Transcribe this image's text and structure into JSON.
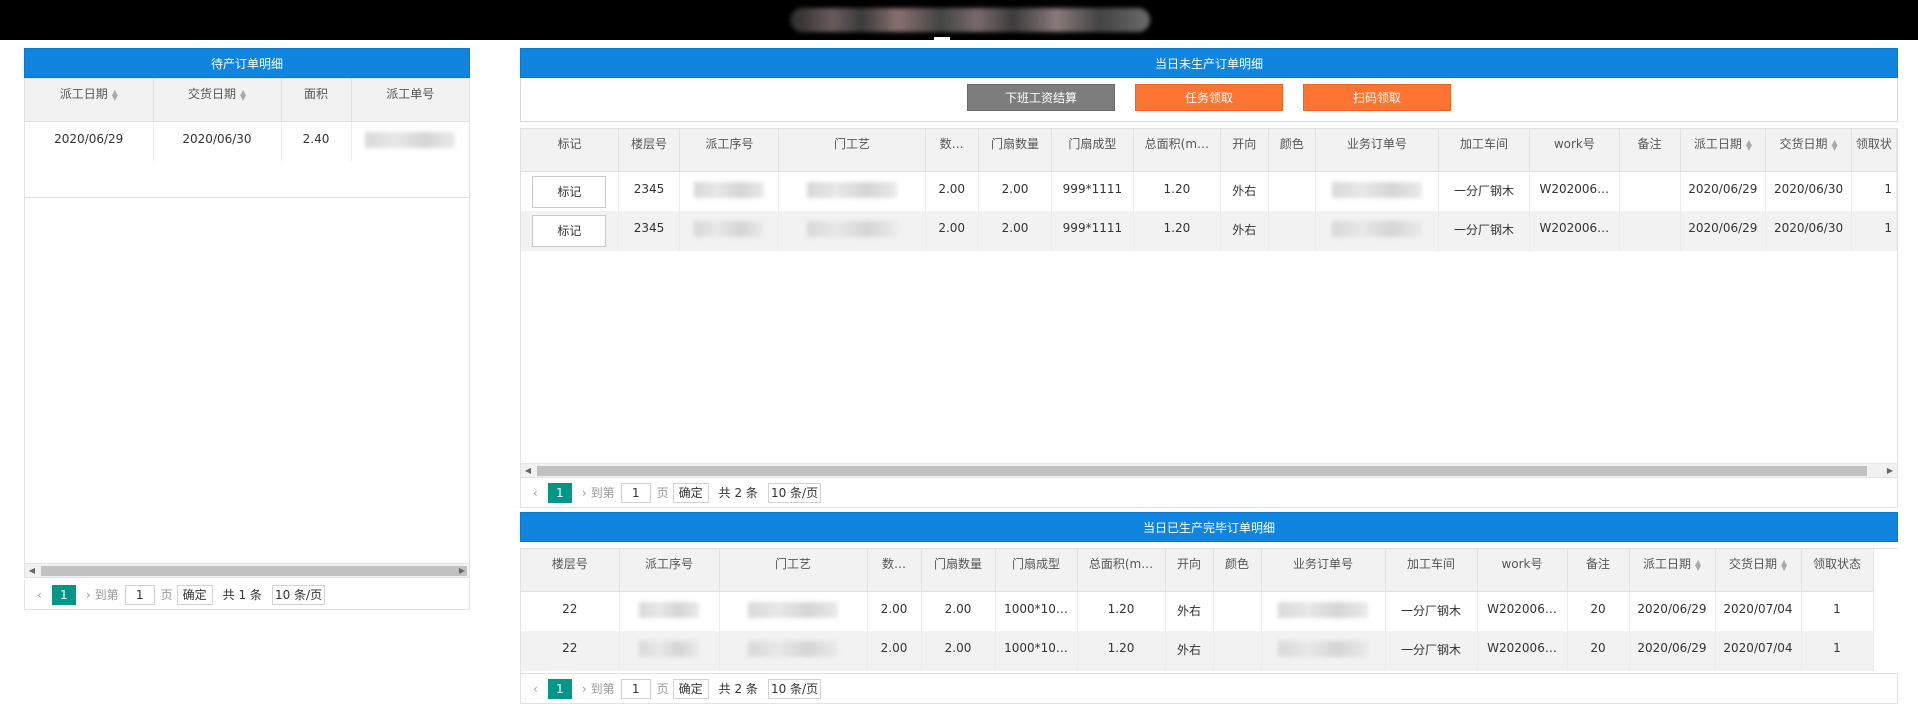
{
  "pending": {
    "title": "待产订单明细",
    "columns": [
      "派工日期",
      "交货日期",
      "面积",
      "派工单号"
    ],
    "rows": [
      {
        "dispatch_date": "2020/06/29",
        "delivery_date": "2020/06/30",
        "area": "2.40"
      }
    ],
    "pager": {
      "current": "1",
      "goto": "到第",
      "page_input": "1",
      "page_unit": "页",
      "confirm": "确定",
      "total": "共 1 条",
      "per_page": "10 条/页"
    }
  },
  "today_unproduced": {
    "title": "当日未生产订单明细",
    "buttons": {
      "settle": "下班工资结算",
      "claim": "任务领取",
      "scan": "扫码领取"
    },
    "columns": [
      "标记",
      "楼层号",
      "派工序号",
      "门工艺",
      "数…",
      "门扇数量",
      "门扇成型",
      "总面积(m…",
      "开向",
      "颜色",
      "业务订单号",
      "加工车间",
      "work号",
      "备注",
      "派工日期",
      "交货日期",
      "领取状"
    ],
    "rows": [
      {
        "mark": "标记",
        "floor": "2345",
        "qty": "2.00",
        "leaf_qty": "2.00",
        "shape": "999*1111",
        "area": "1.20",
        "direction": "外右",
        "workshop": "一分厂钢木",
        "work_no": "W202006…",
        "dispatch_date": "2020/06/29",
        "delivery_date": "2020/06/30",
        "status": "1"
      },
      {
        "mark": "标记",
        "floor": "2345",
        "qty": "2.00",
        "leaf_qty": "2.00",
        "shape": "999*1111",
        "area": "1.20",
        "direction": "外右",
        "workshop": "一分厂钢木",
        "work_no": "W202006…",
        "dispatch_date": "2020/06/29",
        "delivery_date": "2020/06/30",
        "status": "1"
      }
    ],
    "pager": {
      "current": "1",
      "goto": "到第",
      "page_input": "1",
      "page_unit": "页",
      "confirm": "确定",
      "total": "共 2 条",
      "per_page": "10 条/页"
    }
  },
  "today_produced": {
    "title": "当日已生产完毕订单明细",
    "columns": [
      "楼层号",
      "派工序号",
      "门工艺",
      "数…",
      "门扇数量",
      "门扇成型",
      "总面积(m…",
      "开向",
      "颜色",
      "业务订单号",
      "加工车间",
      "work号",
      "备注",
      "派工日期",
      "交货日期",
      "领取状态"
    ],
    "rows": [
      {
        "floor": "22",
        "qty": "2.00",
        "leaf_qty": "2.00",
        "shape": "1000*10…",
        "area": "1.20",
        "direction": "外右",
        "workshop": "一分厂钢木",
        "work_no": "W202006…",
        "remark": "20",
        "dispatch_date": "2020/06/29",
        "delivery_date": "2020/07/04",
        "status": "1"
      },
      {
        "floor": "22",
        "qty": "2.00",
        "leaf_qty": "2.00",
        "shape": "1000*10…",
        "area": "1.20",
        "direction": "外右",
        "workshop": "一分厂钢木",
        "work_no": "W202006…",
        "remark": "20",
        "dispatch_date": "2020/06/29",
        "delivery_date": "2020/07/04",
        "status": "1"
      }
    ],
    "pager": {
      "current": "1",
      "goto": "到第",
      "page_input": "1",
      "page_unit": "页",
      "confirm": "确定",
      "total": "共 2 条",
      "per_page": "10 条/页"
    }
  },
  "colors": {
    "header_blue": "#0f85e0",
    "orange": "#ff7433",
    "gray_button": "#7d7d7d",
    "pager_teal": "#009688"
  }
}
